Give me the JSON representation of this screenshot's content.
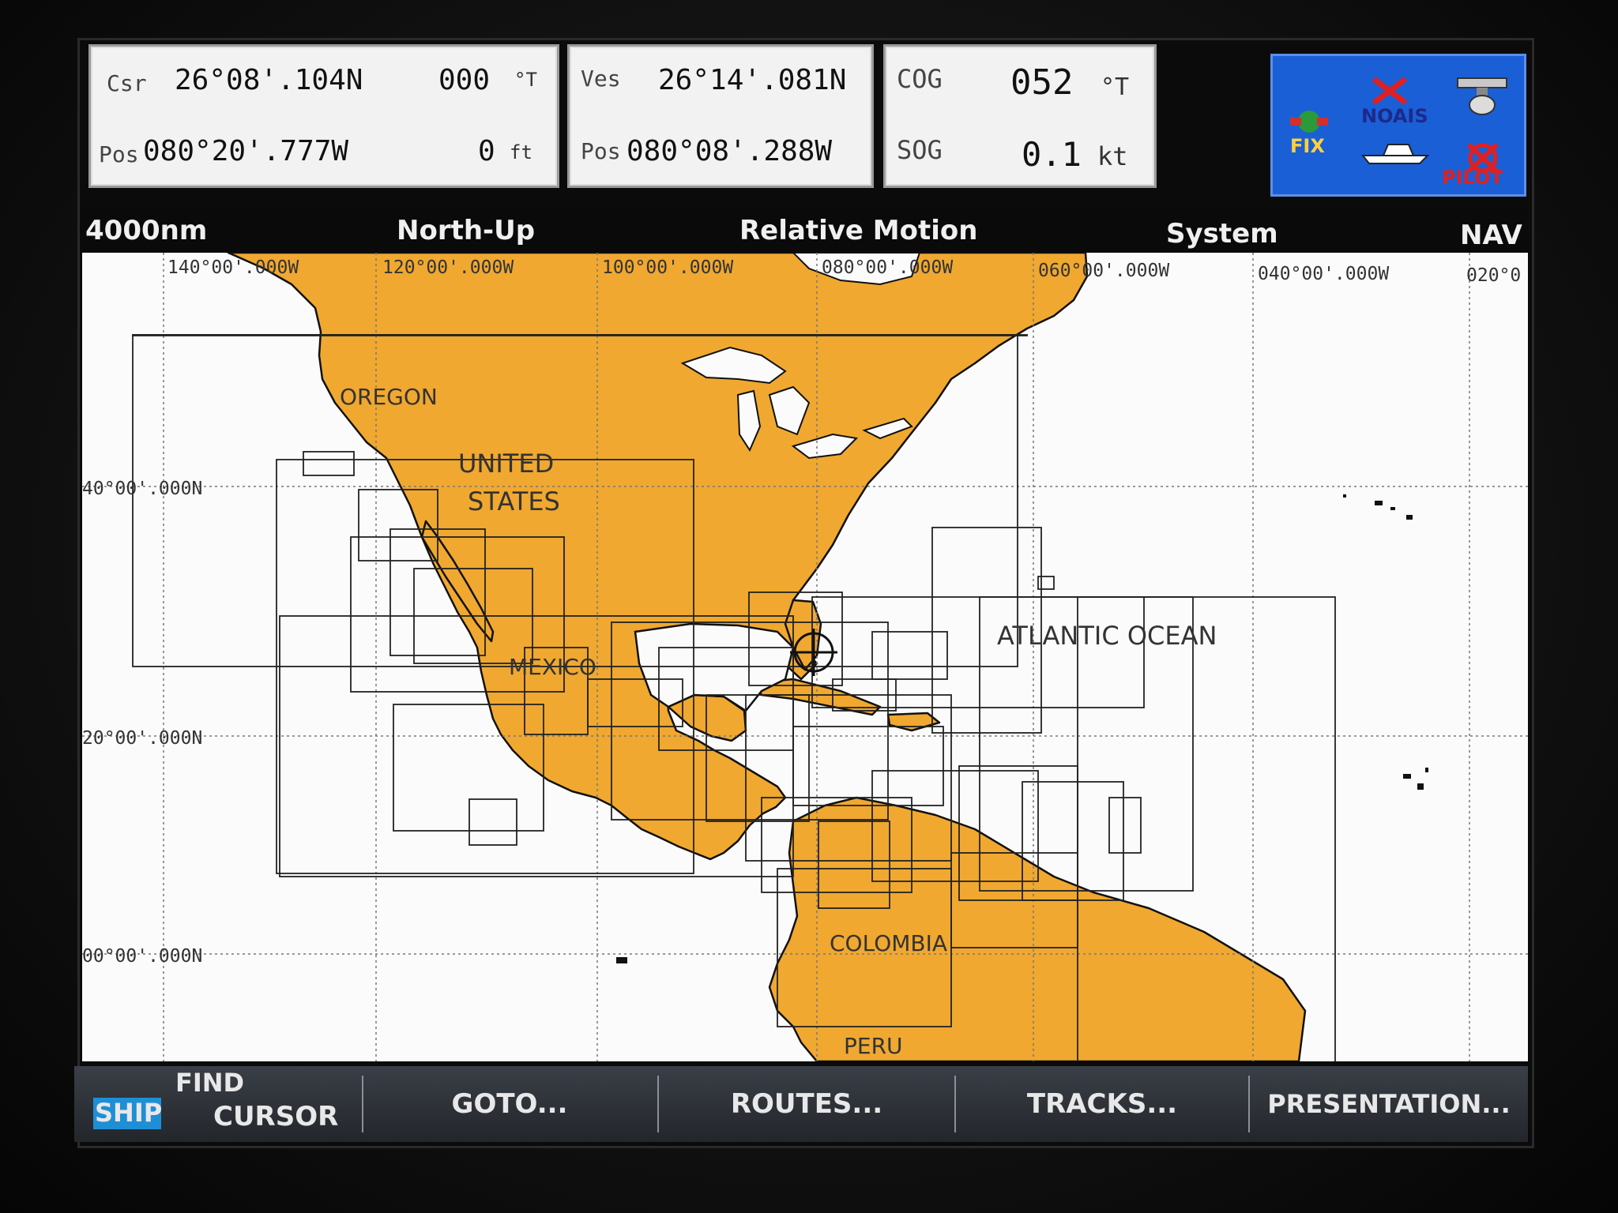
{
  "cursor_box": {
    "csr_label": "Csr",
    "csr_lat": "26°08'.104N",
    "csr_bearing": "000",
    "csr_bearing_unit": "°T",
    "pos_label": "Pos",
    "pos_lon": "080°20'.777W",
    "depth": "0",
    "depth_unit": "ft"
  },
  "vessel_box": {
    "ves_label": "Ves",
    "ves_lat": "26°14'.081N",
    "pos_label": "Pos",
    "pos_lon": "080°08'.288W"
  },
  "course_box": {
    "cog_label": "COG",
    "cog_value": "052",
    "cog_unit": "°T",
    "sog_label": "SOG",
    "sog_value": "0.1",
    "sog_unit": "kt"
  },
  "status_panel": {
    "fix_label": "FIX",
    "noais_label": "NOAIS",
    "pilot_label": "PILOT",
    "icons": [
      "satellite-fix-icon",
      "ais-off-icon",
      "radar-scanner-icon",
      "boat-icon",
      "autopilot-off-icon"
    ],
    "color": "#1a5fd6"
  },
  "title_bar": {
    "range": "4000nm",
    "orientation": "North-Up",
    "motion": "Relative Motion",
    "datum": "System",
    "mode": "NAV"
  },
  "chart": {
    "lon_labels": [
      "140°00'.000W",
      "120°00'.000W",
      "100°00'.000W",
      "080°00'.000W",
      "060°00'.000W",
      "040°00'.000W",
      "020°0"
    ],
    "lat_labels": [
      "40°00'.000N",
      "20°00'.000N",
      "00°00'.000N"
    ],
    "place_labels": {
      "oregon": "OREGON",
      "united": "UNITED",
      "states": "STATES",
      "mexico": "MEXICO",
      "atlantic": "ATLANTIC OCEAN",
      "colombia": "COLOMBIA",
      "peru": "PERU"
    },
    "land_color": "#f0a830",
    "sea_color": "#fbfbfb"
  },
  "softkeys": {
    "ship": "SHIP",
    "find": "FIND",
    "cursor": "CURSOR",
    "goto": "GOTO...",
    "routes": "ROUTES...",
    "tracks": "TRACKS...",
    "presentation": "PRESENTATION..."
  }
}
